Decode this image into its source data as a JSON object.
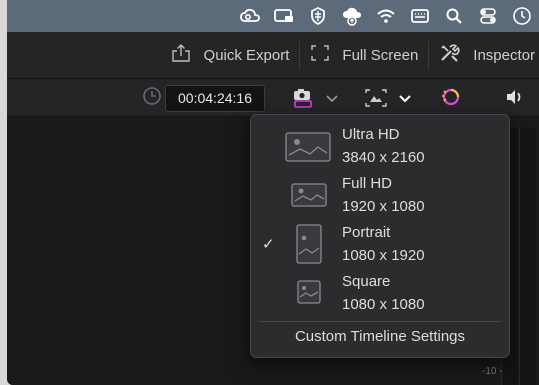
{
  "menubar": {
    "icons": [
      "creative-cloud-icon",
      "screen-recorder-icon",
      "shield-icon",
      "cloud-upload-icon",
      "wifi-icon",
      "keyboard-icon",
      "spotlight-search-icon",
      "control-center-icon",
      "clock-icon"
    ]
  },
  "toolbar": {
    "quick_export_label": "Quick Export",
    "full_screen_label": "Full Screen",
    "inspector_label": "Inspector"
  },
  "viewer_toolbar": {
    "timecode": "00:04:24:16"
  },
  "resolution_menu": {
    "options": [
      {
        "name": "Ultra HD",
        "size": "3840 x 2160",
        "selected": false
      },
      {
        "name": "Full HD",
        "size": "1920 x 1080",
        "selected": false
      },
      {
        "name": "Portrait",
        "size": "1080 x 1920",
        "selected": true
      },
      {
        "name": "Square",
        "size": "1080 x 1080",
        "selected": false
      }
    ],
    "check_mark": "✓",
    "custom_label": "Custom Timeline Settings"
  },
  "meters": {
    "scale_label": "-10 -"
  },
  "colors": {
    "menubar": "#5c6a7a",
    "toolbar": "#252528",
    "dropdown": "#2c2c2f",
    "accent_magenta": "#d63fe0"
  }
}
